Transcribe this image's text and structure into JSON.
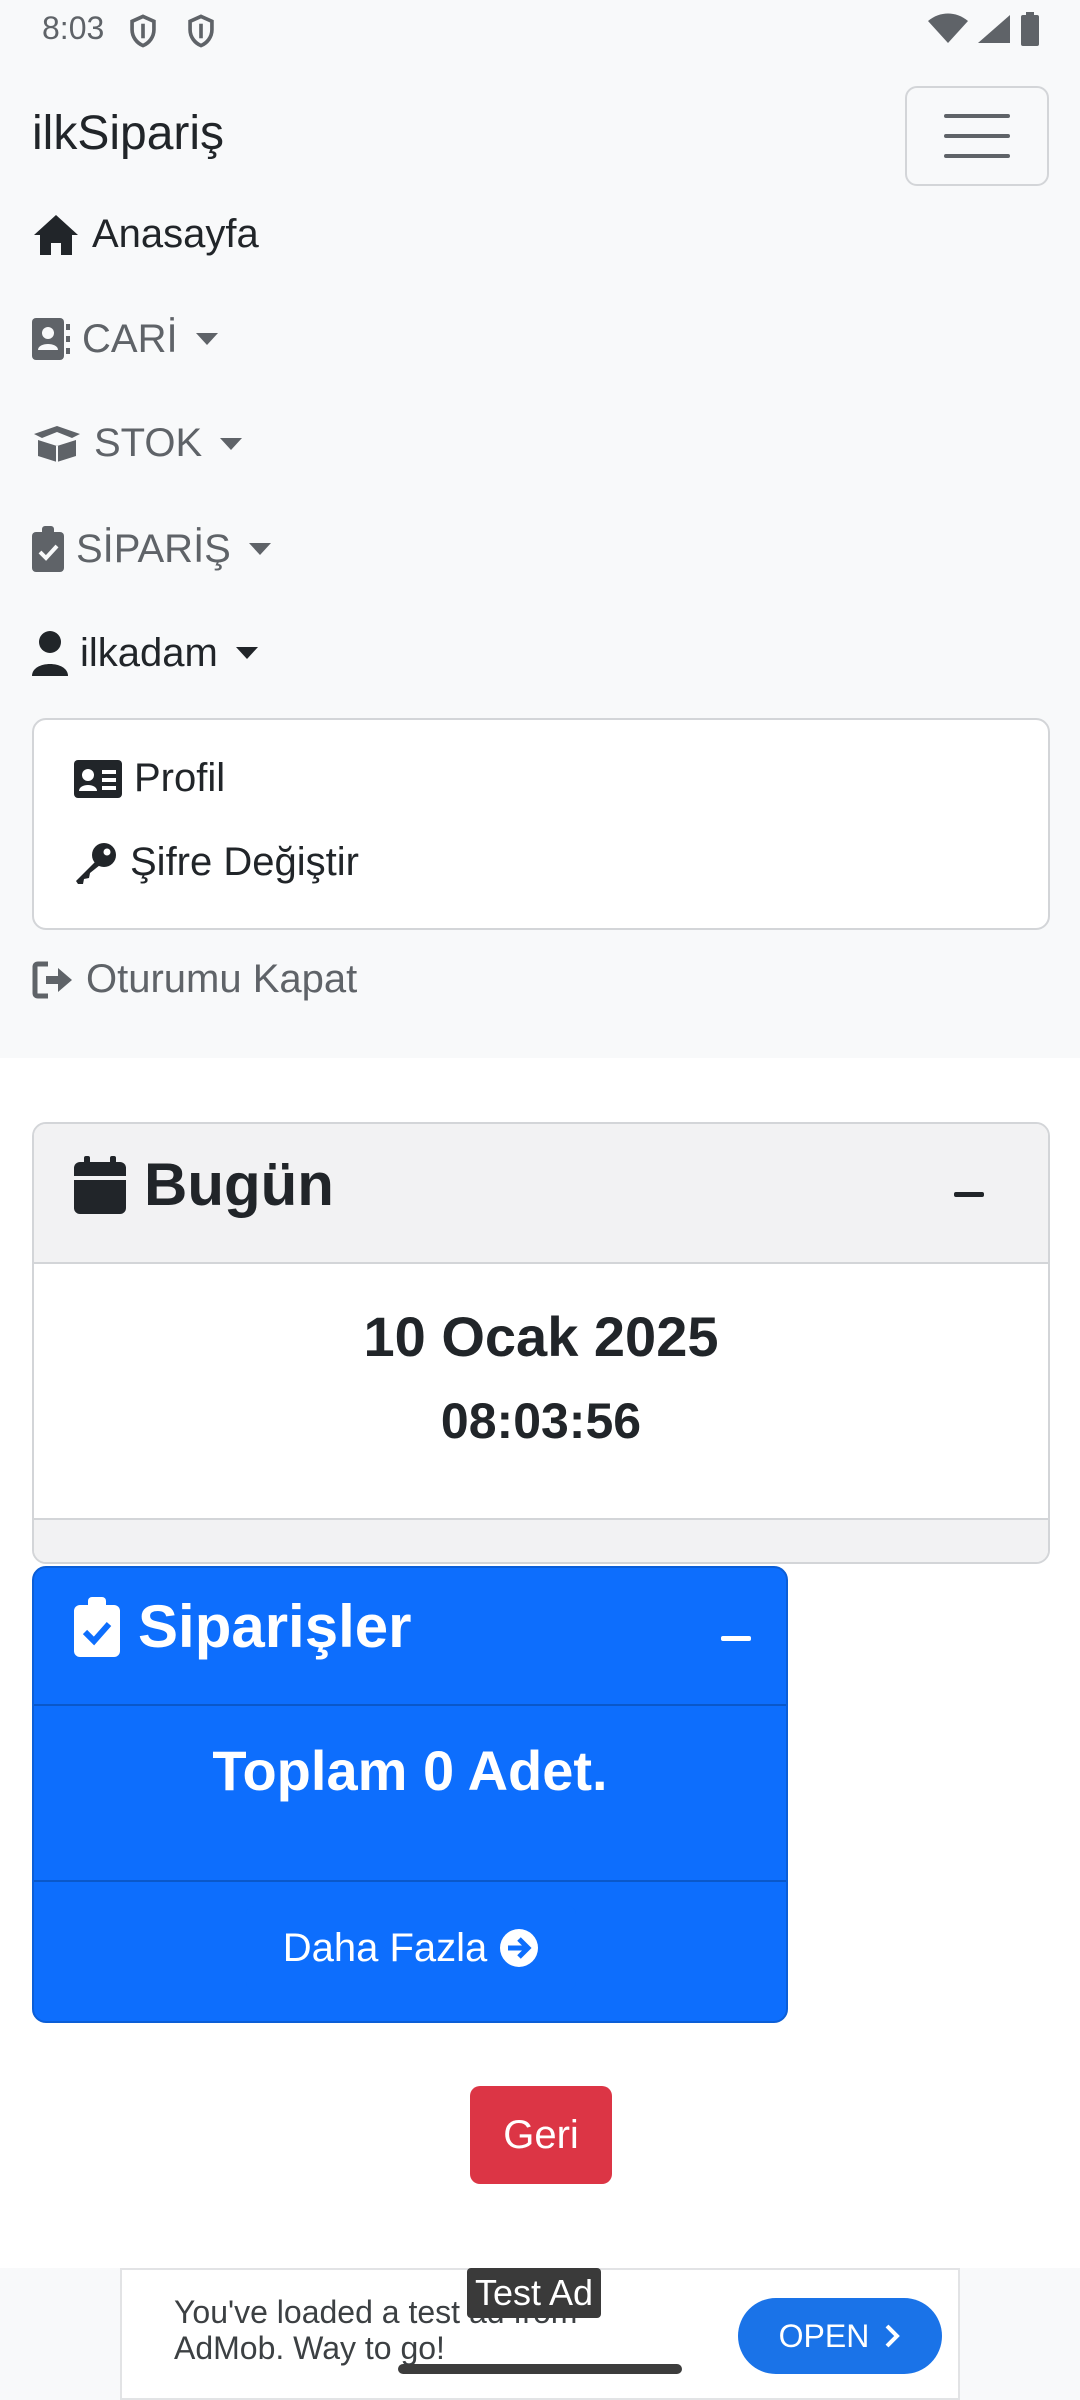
{
  "status_bar": {
    "time": "8:03"
  },
  "navbar": {
    "brand": "ilkSipariş",
    "items": [
      {
        "label": "Anasayfa"
      },
      {
        "label": "CARİ"
      },
      {
        "label": "STOK"
      },
      {
        "label": "SİPARİŞ"
      },
      {
        "label": "ilkadam"
      }
    ],
    "dropdown": [
      {
        "label": "Profil"
      },
      {
        "label": "Şifre Değiştir"
      }
    ],
    "logout": "Oturumu Kapat"
  },
  "today_card": {
    "title": "Bugün",
    "date": "10 Ocak 2025",
    "time": "08:03:56"
  },
  "orders_card": {
    "title": "Siparişler",
    "total": "Toplam 0 Adet.",
    "more": "Daha Fazla"
  },
  "back_button": "Geri",
  "ad": {
    "label": "Test Ad",
    "text": "You've loaded a test ad from AdMob. Way to go!",
    "button": "OPEN"
  },
  "colors": {
    "primary": "#0d6efd",
    "danger": "#dc3545",
    "navbar_bg": "#f8f9fa",
    "ad_button": "#1a73e8"
  }
}
